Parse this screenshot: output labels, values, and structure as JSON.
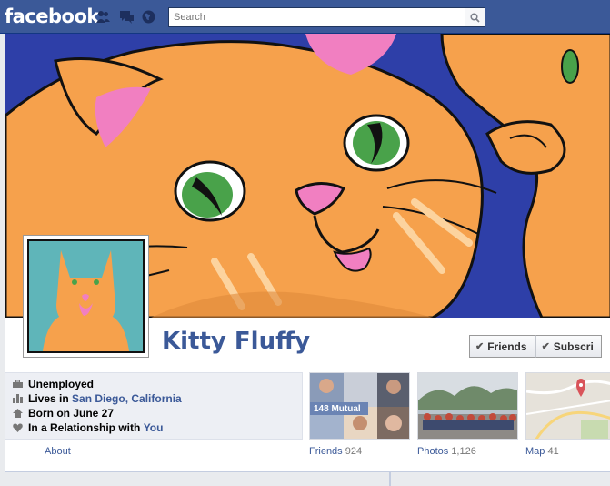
{
  "topbar": {
    "logo": "facebook",
    "search_placeholder": "Search",
    "icons": [
      "friend-requests-icon",
      "messages-icon",
      "notifications-globe-icon",
      "search-icon"
    ]
  },
  "profile": {
    "name": "Kitty Fluffy",
    "buttons": {
      "friends": "Friends",
      "subscribe": "Subscri"
    }
  },
  "info": {
    "work": "Unemployed",
    "lives_prefix": "Lives in",
    "lives_place": "San Diego, California",
    "born": "Born on June 27",
    "relationship_prefix": "In a Relationship with",
    "relationship_partner": "You"
  },
  "about_label": "About",
  "tiles": {
    "friends": {
      "label": "Friends",
      "count": "924",
      "badge": "148 Mutual"
    },
    "photos": {
      "label": "Photos",
      "count": "1,126"
    },
    "map": {
      "label": "Map",
      "count": "41"
    }
  },
  "colors": {
    "brand_blue": "#3b5998",
    "cover_blue": "#2e3fa8",
    "cat_orange": "#f6a14c",
    "cat_pink": "#f17fc1",
    "eye_green": "#49a24a",
    "pic_teal": "#5fb5b9"
  }
}
